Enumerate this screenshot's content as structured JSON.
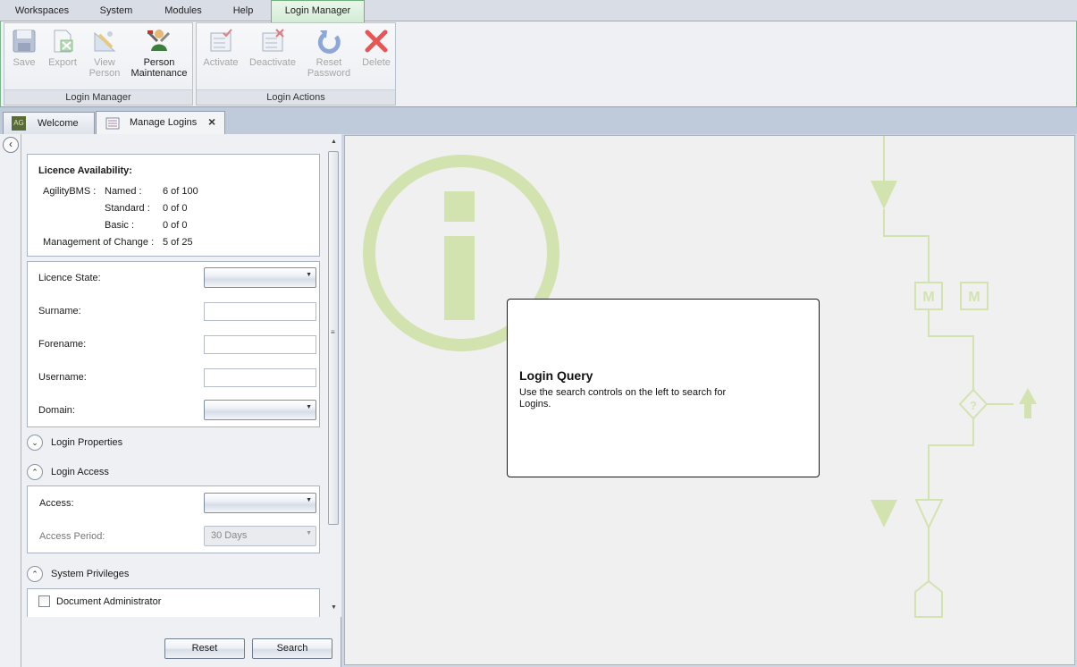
{
  "menu": {
    "tabs": [
      "Workspaces",
      "System",
      "Modules",
      "Help",
      "Login Manager"
    ]
  },
  "ribbon": {
    "group1": {
      "label": "Login Manager",
      "buttons": [
        {
          "line1": "Save",
          "line2": ""
        },
        {
          "line1": "Export",
          "line2": ""
        },
        {
          "line1": "View",
          "line2": "Person"
        },
        {
          "line1": "Person",
          "line2": "Maintenance"
        }
      ]
    },
    "group2": {
      "label": "Login Actions",
      "buttons": [
        {
          "line1": "Activate",
          "line2": ""
        },
        {
          "line1": "Deactivate",
          "line2": ""
        },
        {
          "line1": "Reset",
          "line2": "Password"
        },
        {
          "line1": "Delete",
          "line2": ""
        }
      ]
    }
  },
  "doc_tabs": {
    "welcome": "Welcome",
    "welcome_badge": "AG",
    "manage": "Manage Logins"
  },
  "licence": {
    "title": "Licence Availability:",
    "product": "AgilityBMS :",
    "rows": [
      {
        "label": "Named :",
        "value": "6 of 100"
      },
      {
        "label": "Standard :",
        "value": "0 of 0"
      },
      {
        "label": "Basic :",
        "value": "0 of 0"
      }
    ],
    "moc_label": "Management of Change :",
    "moc_value": "5 of 25"
  },
  "search_form": {
    "licence_state": "Licence State:",
    "surname": "Surname:",
    "forename": "Forename:",
    "username": "Username:",
    "domain": "Domain:"
  },
  "sections": {
    "login_properties": "Login Properties",
    "login_access": "Login Access",
    "system_privileges": "System Privileges"
  },
  "access": {
    "access_label": "Access:",
    "period_label": "Access Period:",
    "period_value": "30 Days"
  },
  "privileges": {
    "doc_admin": "Document Administrator"
  },
  "buttons": {
    "reset": "Reset",
    "search": "Search"
  },
  "query": {
    "title": "Login Query",
    "text": "Use the search controls on the left to search for Logins."
  },
  "diagram": {
    "m1": "M",
    "m2": "M",
    "decision": "?"
  },
  "colors": {
    "accent_green": "#d3e3b0",
    "ribbon_border": "#79b68b",
    "delete_red": "#e85555"
  }
}
